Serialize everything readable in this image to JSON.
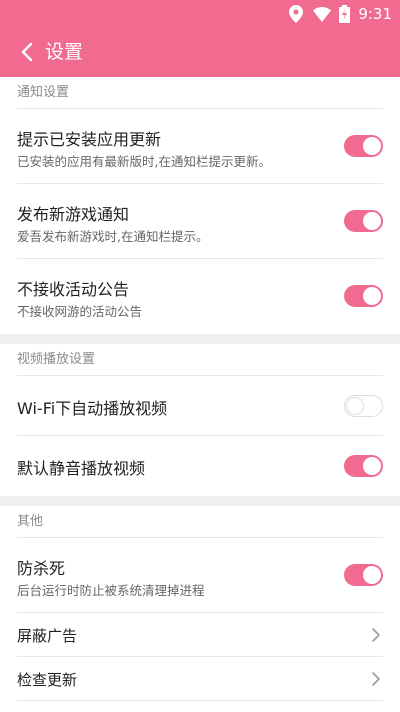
{
  "status_bar": {
    "time": "9:31"
  },
  "app_bar": {
    "title": "设置"
  },
  "sections": [
    {
      "header": "通知设置",
      "items": [
        {
          "title": "提示已安装应用更新",
          "subtitle": "已安装的应用有最新版时,在通知栏提示更新。",
          "toggle": true
        },
        {
          "title": "发布新游戏通知",
          "subtitle": "爱吾发布新游戏时,在通知栏提示。",
          "toggle": true
        },
        {
          "title": "不接收活动公告",
          "subtitle": "不接收网游的活动公告",
          "toggle": true
        }
      ]
    },
    {
      "header": "视频播放设置",
      "items": [
        {
          "title": "Wi-Fi下自动播放视频",
          "toggle": false
        },
        {
          "title": "默认静音播放视频",
          "toggle": true
        }
      ]
    },
    {
      "header": "其他",
      "items": [
        {
          "title": "防杀死",
          "subtitle": "后台运行时防止被系统清理掉进程",
          "toggle": true
        },
        {
          "title": "屏蔽广告"
        },
        {
          "title": "检查更新"
        }
      ]
    }
  ],
  "colors": {
    "accent": "#f06b8f",
    "divider": "#e8e8e8",
    "gap": "#efefef"
  }
}
